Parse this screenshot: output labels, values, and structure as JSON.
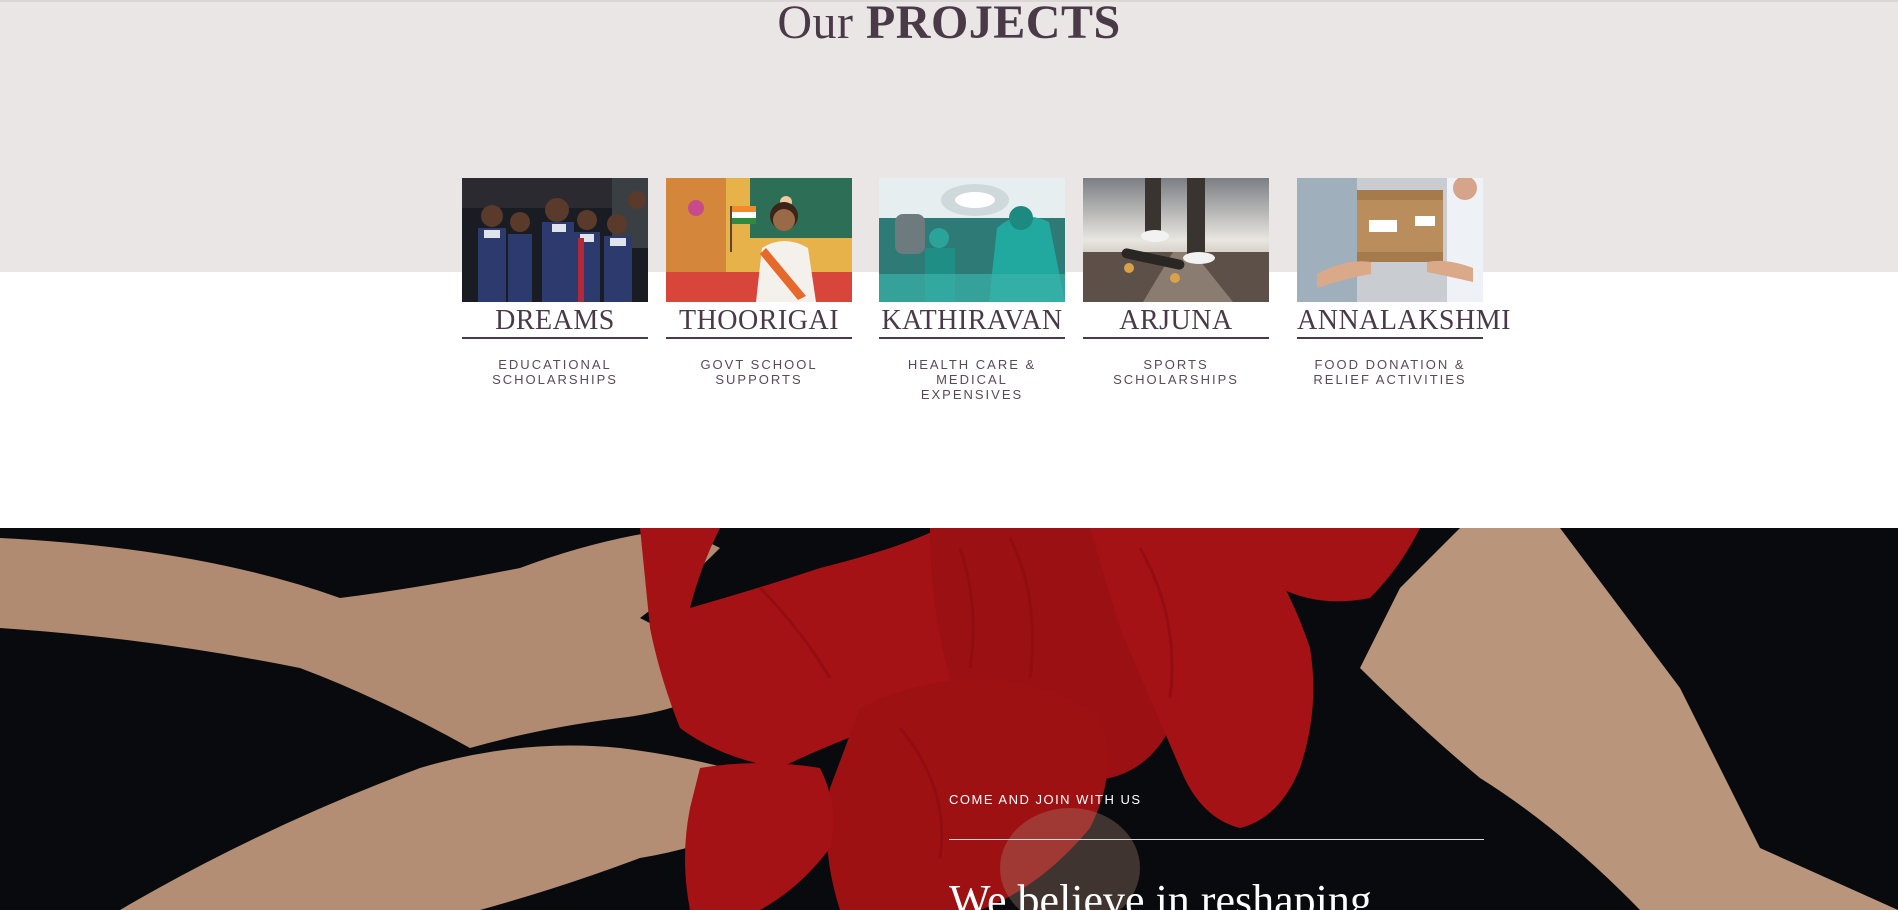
{
  "section": {
    "heading_light": "Our",
    "heading_bold": "PROJECTS"
  },
  "projects": [
    {
      "name": "DREAMS",
      "desc": "EDUCATIONAL\nSCHOLARSHIPS",
      "image": "school-children-photo"
    },
    {
      "name": "THOORIGAI",
      "desc": "GOVT SCHOOL\nSUPPORTS",
      "image": "girl-with-flag-photo"
    },
    {
      "name": "KATHIRAVAN",
      "desc": "HEALTH CARE &\nMEDICAL EXPENSIVES",
      "image": "surgery-room-photo"
    },
    {
      "name": "ARJUNA",
      "desc": "SPORTS\nSCHOLARSHIPS",
      "image": "skateboard-photo"
    },
    {
      "name": "ANNALAKSHMI",
      "desc": "FOOD DONATION &\nRELIEF ACTIVITIES",
      "image": "food-box-photo"
    }
  ],
  "join": {
    "kicker": "COME AND JOIN WITH US",
    "headline": "We believe in reshaping",
    "background_image": "red-painted-hands-photo"
  },
  "colors": {
    "band": "#ebe6e6",
    "text": "#4a3a48",
    "dark": "#0b0d12",
    "paint_red": "#c8161a"
  }
}
